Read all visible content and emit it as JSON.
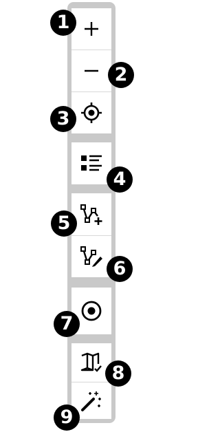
{
  "toolbar": {
    "tools": [
      {
        "name": "zoom-in",
        "icon": "plus-icon",
        "callout": "1"
      },
      {
        "name": "zoom-out",
        "icon": "minus-icon",
        "callout": "2"
      },
      {
        "name": "locate",
        "icon": "crosshair-icon",
        "callout": "3"
      },
      {
        "name": "layers-list",
        "icon": "list-icon",
        "callout": "4"
      },
      {
        "name": "draw-add",
        "icon": "polyline-add-icon",
        "callout": "5"
      },
      {
        "name": "draw-edit",
        "icon": "polyline-edit-icon",
        "callout": "6"
      },
      {
        "name": "target",
        "icon": "target-circle-icon",
        "callout": "7"
      },
      {
        "name": "map-check",
        "icon": "map-check-icon",
        "callout": "8"
      },
      {
        "name": "magic-wand",
        "icon": "magic-wand-icon",
        "callout": "9"
      }
    ]
  },
  "colors": {
    "frame": "#c9c9c9",
    "button": "#ffffff",
    "icon": "#000000",
    "badge": "#000000",
    "badge_text": "#ffffff"
  }
}
